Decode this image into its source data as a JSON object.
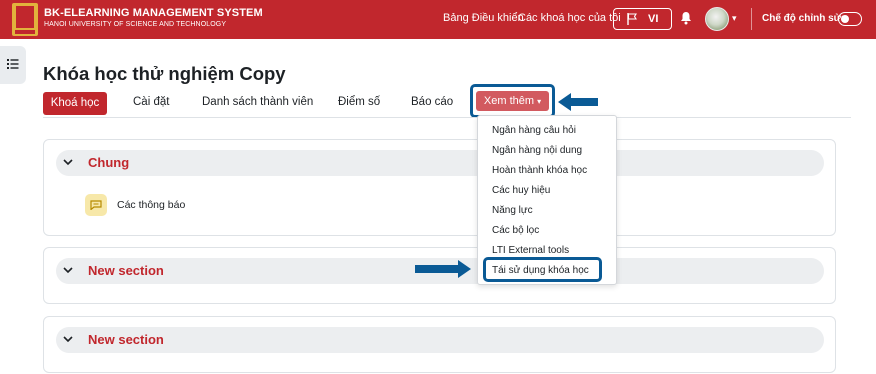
{
  "header": {
    "brand_title": "BK-ELEARNING MANAGEMENT SYSTEM",
    "brand_subtitle": "HANOI UNIVERSITY OF SCIENCE AND TECHNOLOGY",
    "nav_dashboard": "Bảng Điều khiển",
    "nav_my_courses": "Các khoá học của tôi",
    "language": "VI",
    "edit_mode_label": "Chế độ chỉnh sửa"
  },
  "course": {
    "title": "Khóa học thử nghiệm Copy"
  },
  "tabs": {
    "course": "Khoá học",
    "settings": "Cài đặt",
    "participants": "Danh sách thành viên",
    "grades": "Điểm số",
    "reports": "Báo cáo",
    "more": "Xem thêm"
  },
  "more_menu": {
    "items": [
      "Ngân hàng câu hỏi",
      "Ngân hàng nội dung",
      "Hoàn thành khóa học",
      "Các huy hiệu",
      "Năng lực",
      "Các bộ lọc",
      "LTI External tools",
      "Tái sử dụng khóa học"
    ],
    "highlighted_item": "Tái sử dụng khóa học"
  },
  "sections": [
    {
      "title": "Chung",
      "activities": [
        "Các thông báo"
      ]
    },
    {
      "title": "New section"
    },
    {
      "title": "New section"
    }
  ],
  "colors": {
    "brand_red": "#c1272d",
    "annotation_blue": "#0a5a95",
    "more_button": "#d25a5f"
  }
}
